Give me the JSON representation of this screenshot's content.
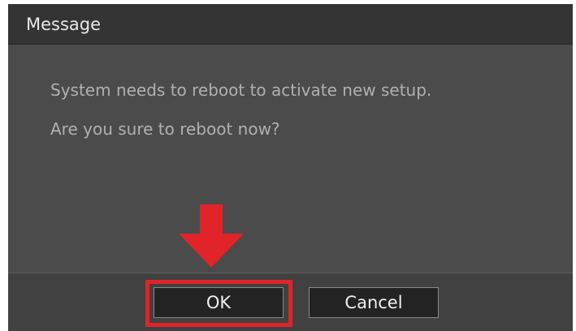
{
  "dialog": {
    "title": "Message",
    "lines": [
      "System needs to reboot to activate new setup.",
      "Are you sure to reboot now?"
    ],
    "buttons": {
      "ok": "OK",
      "cancel": "Cancel"
    }
  },
  "annotation": {
    "color": "#e0242a",
    "icon": "arrow-down-icon"
  }
}
